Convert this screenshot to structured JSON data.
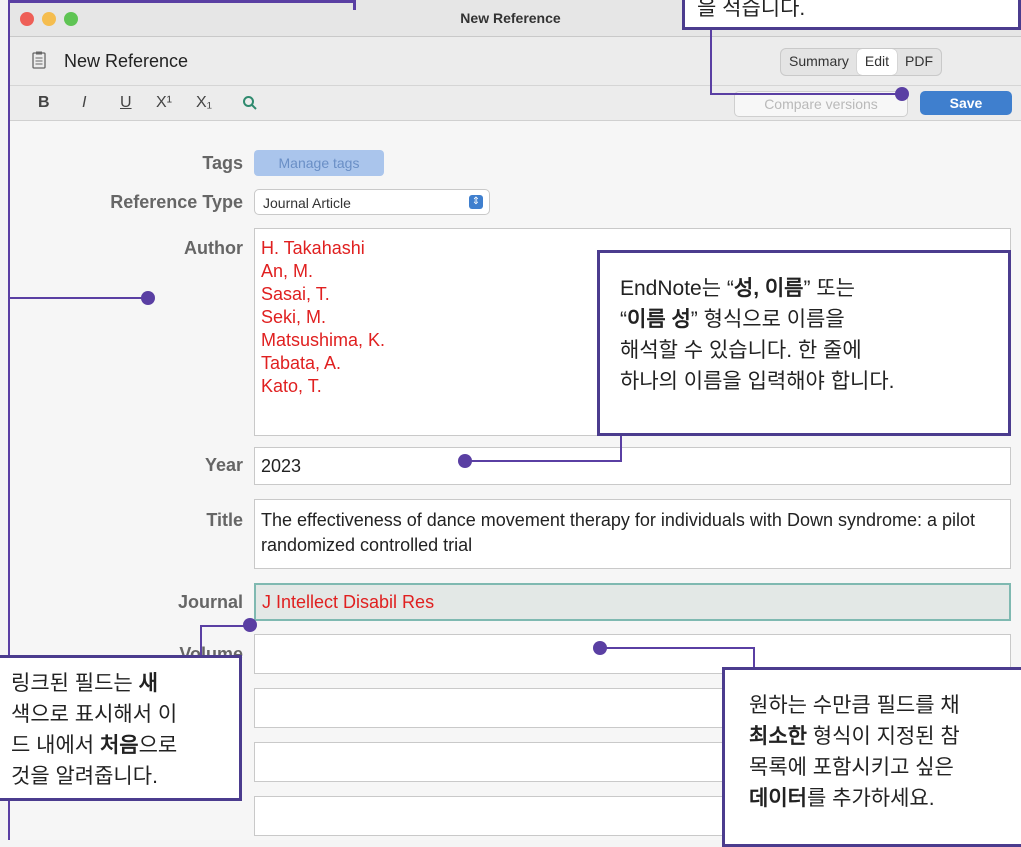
{
  "window": {
    "title": "New Reference"
  },
  "header": {
    "title": "New Reference",
    "tabs": [
      {
        "label": "Summary"
      },
      {
        "label": "Edit",
        "active": true
      },
      {
        "label": "PDF"
      }
    ]
  },
  "toolbar": {
    "bold": "B",
    "italic": "I",
    "underline": "U",
    "superscript": "X¹",
    "subscript": "X₁",
    "compare_label": "Compare versions",
    "save_label": "Save"
  },
  "form": {
    "tags_label": "Tags",
    "tags_button": "Manage tags",
    "reftype_label": "Reference Type",
    "reftype_value": "Journal Article",
    "author_label": "Author",
    "authors": [
      "H. Takahashi",
      "An, M.",
      "Sasai, T.",
      "Seki, M.",
      "Matsushima, K.",
      "Tabata, A.",
      "Kato, T."
    ],
    "year_label": "Year",
    "year_value": "2023",
    "title_label": "Title",
    "title_value": "The effectiveness of dance movement therapy for individuals with Down syndrome: a pilot randomized controlled trial",
    "journal_label": "Journal",
    "journal_value": "J Intellect Disabil Res",
    "volume_label": "Volume"
  },
  "callouts": {
    "top": "을 적습니다.",
    "names_l1_a": "EndNote는 “",
    "names_l1_b": "성, 이름",
    "names_l1_c": "” 또는",
    "names_l2_a": "“",
    "names_l2_b": "이름 성",
    "names_l2_c": "” 형식으로 이름을",
    "names_l3": "해석할 수 있습니다. 한 줄에",
    "names_l4": "하나의 이름을 입력해야 합니다.",
    "linked_l1_a": "링크된 필드는 ",
    "linked_l1_b": "새",
    "linked_l2": "색으로 표시해서 이",
    "linked_l3_a": "드 내에서 ",
    "linked_l3_b": "처음",
    "linked_l3_c": "으로",
    "linked_l4": "것을 알려줍니다.",
    "fields_l1": "원하는 수만큼 필드를 채",
    "fields_l2_a": "최소한",
    "fields_l2_b": " 형식이 지정된 참",
    "fields_l3": "목록에 포함시키고 싶은",
    "fields_l4_a": "데이터",
    "fields_l4_b": "를 추가하세요."
  },
  "colors": {
    "accent": "#5a3fa3",
    "save": "#3f7fce",
    "author_text": "#e02020"
  }
}
